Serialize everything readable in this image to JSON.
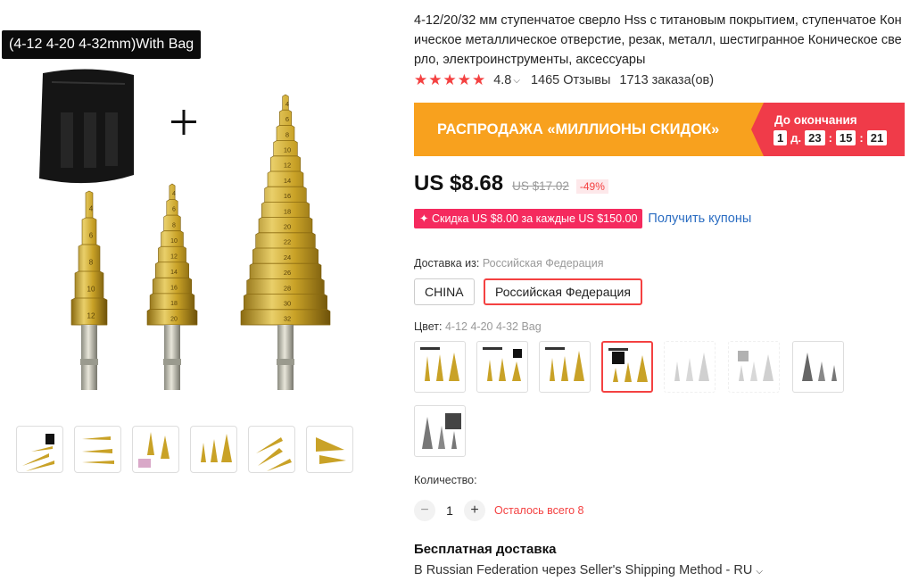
{
  "gallery": {
    "variant_tag": "(4-12 4-20 4-32mm)With Bag",
    "main_image_alt": "step-drill-set-with-bag",
    "drill_marks_small": [
      "4",
      "6",
      "8",
      "10",
      "12"
    ],
    "drill_marks_medium": [
      "4",
      "6",
      "8",
      "10",
      "12",
      "14",
      "16",
      "18",
      "20"
    ],
    "drill_marks_large": [
      "4",
      "6",
      "8",
      "10",
      "12",
      "14",
      "16",
      "18",
      "20",
      "22",
      "24",
      "26",
      "28",
      "30",
      "32"
    ],
    "thumbnail_count": 6
  },
  "product": {
    "title": "4-12/20/32 мм ступенчатое сверло Hss с титановым покрытием, ступенчатое Коническое металлическое отверстие, резак, металл, шестигранное Коническое сверло, электроинструменты, аксессуары",
    "stars": "★★★★★",
    "rating": "4.8",
    "reviews": "1465 Отзывы",
    "orders": "1713 заказа(ов)"
  },
  "sale": {
    "banner_text": "РАСПРОДАЖА «МИЛЛИОНЫ СКИДОК»",
    "ends_label": "До окончания",
    "days": "1",
    "days_unit": "д.",
    "hours": "23",
    "minutes": "15",
    "seconds": "21"
  },
  "price": {
    "current": "US $8.68",
    "old": "US $17.02",
    "discount": "-49%"
  },
  "coupon": {
    "text": "✦ Скидка US $8.00 за каждые US $150.00",
    "link": "Получить купоны"
  },
  "shipping_from": {
    "label": "Доставка из:",
    "value": "Российская Федерация",
    "options": [
      "CHINA",
      "Российская Федерация"
    ],
    "selected_index": 1
  },
  "color": {
    "label": "Цвет:",
    "value": "4-12 4-20 4-32 Bag",
    "selected_index": 3
  },
  "quantity": {
    "label": "Количество:",
    "minus": "−",
    "value": "1",
    "plus": "+",
    "stock": "Осталось всего 8"
  },
  "delivery": {
    "title": "Бесплатная доставка",
    "method": "В Russian Federation через Seller's Shipping Method - RU"
  },
  "colors": {
    "gold": "#c9a227",
    "accent_red": "#f44141",
    "sale_orange": "#f8a11e",
    "coupon_pink": "#f52a5e",
    "link_blue": "#2b6dc2"
  },
  "icons": {
    "chevron": "chevron-down-icon",
    "plus": "plus-icon"
  }
}
